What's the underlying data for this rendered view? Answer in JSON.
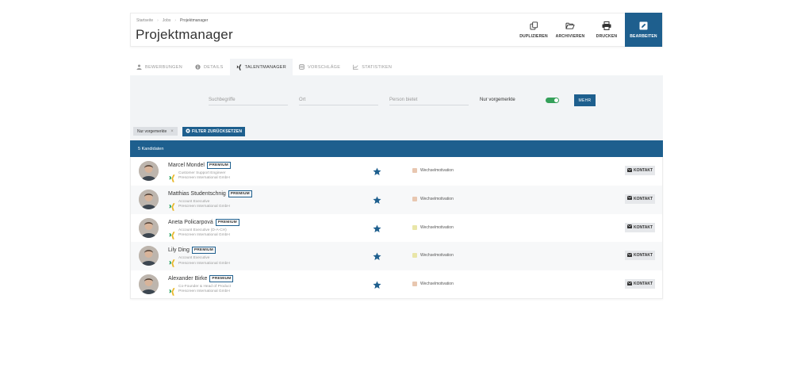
{
  "breadcrumb": [
    "Startseite",
    "Jobs",
    "Projektmanager"
  ],
  "page_title": "Projektmanager",
  "actions": {
    "duplicate": "DUPLIZIEREN",
    "archive": "ARCHIVIEREN",
    "print": "DRUCKEN",
    "edit": "BEARBEITEN"
  },
  "tabs": [
    {
      "label": "BEWERBUNGEN",
      "icon": "user-icon",
      "active": false
    },
    {
      "label": "DETAILS",
      "icon": "info-icon",
      "active": false
    },
    {
      "label": "TALENTMANAGER",
      "icon": "xing-icon",
      "active": true
    },
    {
      "label": "VORSCHLÄGE",
      "icon": "database-icon",
      "active": false
    },
    {
      "label": "STATISTIKEN",
      "icon": "chart-icon",
      "active": false
    }
  ],
  "filters": {
    "search_placeholder": "Suchbegriffe",
    "location_placeholder": "Ort",
    "person_placeholder": "Person bietet",
    "toggle_label": "Nur vorgemerkte",
    "toggle_on": true,
    "more_label": "MEHR",
    "chip_label": "Nur vorgemerkte",
    "chip_remove": "×",
    "reset_label": "FILTER ZURÜCKSETZEN"
  },
  "results_count": "5 Kandidaten",
  "colors": {
    "primary": "#1e5f8e",
    "toggle_on": "#35a05a",
    "star": "#1e5f8e",
    "premium_border": "#1e5f8e",
    "xing_green": "#1a9e5a",
    "xing_yellow": "#e8b82a"
  },
  "candidates": [
    {
      "name": "Marcel Mondel",
      "badge": "PREMIUM",
      "position": "Customer Support Engineer",
      "company": "Prescreen International GmbH",
      "motivation": "Wechselmotivation",
      "motivation_color": "#e8c7b0",
      "contact": "KONTAKT",
      "starred": true
    },
    {
      "name": "Matthias Studentschnig",
      "badge": "PREMIUM",
      "position": "Account Executive",
      "company": "Prescreen International GmbH",
      "motivation": "Wechselmotivation",
      "motivation_color": "#e8c7b0",
      "contact": "KONTAKT",
      "starred": true
    },
    {
      "name": "Aneta Policarpová",
      "badge": "PREMIUM",
      "position": "Account Executive (D-A-CH)",
      "company": "Prescreen International GmbH",
      "motivation": "Wechselmotivation",
      "motivation_color": "#e9e6a8",
      "contact": "KONTAKT",
      "starred": true
    },
    {
      "name": "Lily Ding",
      "badge": "PREMIUM",
      "position": "Account Executive",
      "company": "Prescreen International GmbH",
      "motivation": "Wechselmotivation",
      "motivation_color": "#e9e6a8",
      "contact": "KONTAKT",
      "starred": true
    },
    {
      "name": "Alexander Birke",
      "badge": "PREMIUM",
      "position": "Co-Founder & Head of Product",
      "company": "Prescreen International GmbH",
      "motivation": "Wechselmotivation",
      "motivation_color": "#e8c7b0",
      "contact": "KONTAKT",
      "starred": true
    }
  ]
}
